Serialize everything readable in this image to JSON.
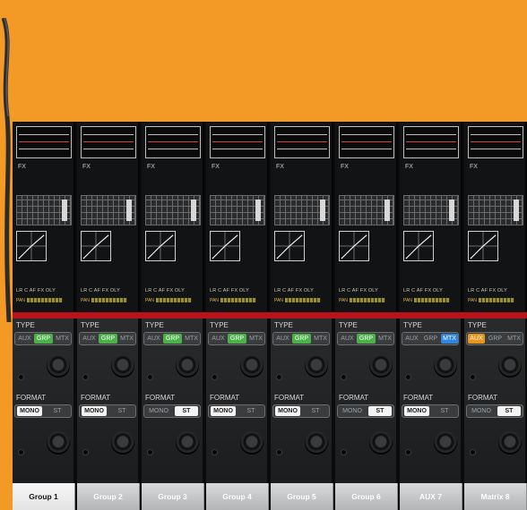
{
  "colors": {
    "background_orange": "#f39a26",
    "console_bg": "#0b0b0c",
    "red_line": "#b8121b",
    "grp_active": "#4bb24a",
    "mtx_active": "#2f86e0",
    "aux_active": "#e8951a"
  },
  "labels": {
    "fx": "FX",
    "type": "TYPE",
    "format": "FORMAT",
    "aux": "AUX",
    "grp": "GRP",
    "mtx": "MTX",
    "mono": "MONO",
    "st": "ST",
    "bus_row": "LR  C  AF  FX  DLY",
    "pan": "PAN"
  },
  "strips": [
    {
      "name": "Group 1",
      "type": "GRP",
      "format": "MONO",
      "active": true
    },
    {
      "name": "Group 2",
      "type": "GRP",
      "format": "MONO",
      "active": false
    },
    {
      "name": "Group 3",
      "type": "GRP",
      "format": "ST",
      "active": false
    },
    {
      "name": "Group 4",
      "type": "GRP",
      "format": "MONO",
      "active": false
    },
    {
      "name": "Group 5",
      "type": "GRP",
      "format": "MONO",
      "active": false
    },
    {
      "name": "Group 6",
      "type": "GRP",
      "format": "ST",
      "active": false
    },
    {
      "name": "AUX 7",
      "type": "MTX",
      "format": "MONO",
      "active": false
    },
    {
      "name": "Matrix 8",
      "type": "AUX",
      "format": "ST",
      "active": false
    }
  ]
}
